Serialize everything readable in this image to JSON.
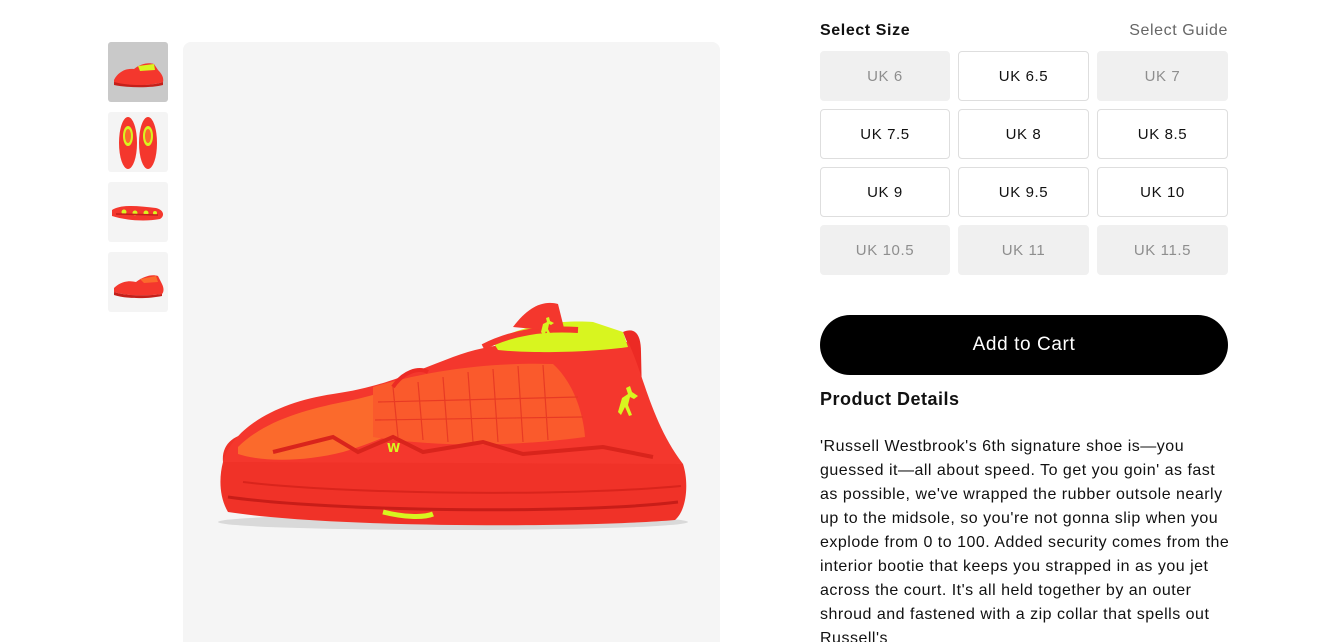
{
  "gallery": {
    "thumbnails": [
      {
        "icon": "shoe-side-view-thumbnail",
        "selected": true
      },
      {
        "icon": "shoe-top-view-thumbnail",
        "selected": false
      },
      {
        "icon": "shoe-sole-view-thumbnail",
        "selected": false
      },
      {
        "icon": "shoe-angled-view-thumbnail",
        "selected": false
      }
    ],
    "main_image": "red-orange-basketball-shoe-with-volt-accents"
  },
  "size": {
    "title": "Select Size",
    "guide_label": "Select Guide",
    "options": [
      {
        "label": "UK 6",
        "available": false
      },
      {
        "label": "UK 6.5",
        "available": true
      },
      {
        "label": "UK 7",
        "available": false
      },
      {
        "label": "UK 7.5",
        "available": true
      },
      {
        "label": "UK 8",
        "available": true
      },
      {
        "label": "UK 8.5",
        "available": true
      },
      {
        "label": "UK 9",
        "available": true
      },
      {
        "label": "UK 9.5",
        "available": true
      },
      {
        "label": "UK 10",
        "available": true
      },
      {
        "label": "UK 10.5",
        "available": false
      },
      {
        "label": "UK 11",
        "available": false
      },
      {
        "label": "UK 11.5",
        "available": false
      }
    ]
  },
  "cart": {
    "add_label": "Add to Cart"
  },
  "details": {
    "title": "Product Details",
    "description": "'Russell Westbrook's 6th signature shoe is—you guessed it—all about speed. To get you goin' as fast as possible, we've wrapped the rubber outsole nearly up to the midsole, so you're not gonna slip when you explode from 0 to 100. Added security comes from the interior bootie that keeps you strapped in as you jet across the court. It's all held together by an outer shroud and fastened with a zip collar that spells out Russell's"
  },
  "colors": {
    "shoe_red": "#f4372d",
    "shoe_orange": "#fb6a2c",
    "volt": "#d8f51f",
    "button_black": "#000000"
  }
}
